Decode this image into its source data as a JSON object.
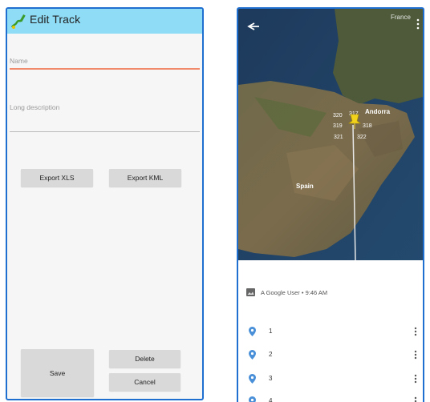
{
  "edit_track": {
    "title": "Edit Track",
    "name_placeholder": "Name",
    "description_placeholder": "Long description",
    "buttons": {
      "export_xls": "Export XLS",
      "export_kml": "Export KML",
      "save": "Save",
      "delete": "Delete",
      "cancel": "Cancel"
    },
    "colors": {
      "app_bar": "#8fdcf6",
      "name_underline": "#f08a6a"
    }
  },
  "map_view": {
    "map_labels": {
      "country_top": "France",
      "country_main": "Spain",
      "region": "Andorra",
      "markers": [
        "320",
        "317",
        "319",
        "318",
        "321",
        "322"
      ]
    },
    "photo_attribution": "A Google User • 9:46 AM",
    "points": [
      "1",
      "2",
      "3",
      "4"
    ]
  }
}
